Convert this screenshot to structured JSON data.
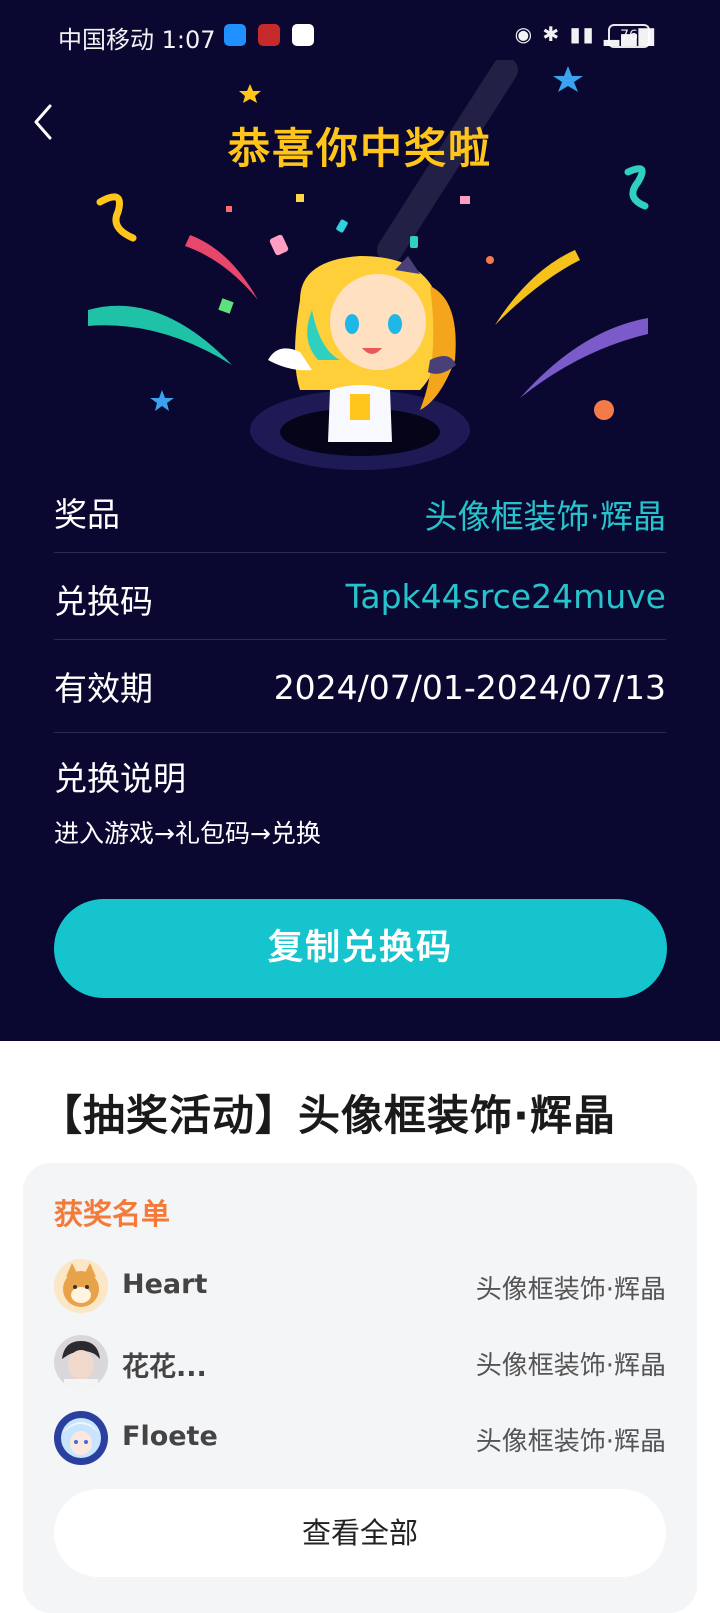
{
  "status_bar": {
    "carrier_time": "中国移动 1:07",
    "battery": "76"
  },
  "header": {
    "title": "恭喜你中奖啦"
  },
  "prize_info": {
    "prize_label": "奖品",
    "prize_value": "头像框装饰·辉晶",
    "code_label": "兑换码",
    "code_value": "Tapk44srce24muve",
    "validity_label": "有效期",
    "validity_value": "2024/07/01-2024/07/13",
    "explain_title": "兑换说明",
    "explain_text": "进入游戏→礼包码→兑换"
  },
  "copy_button": {
    "label": "复制兑换码"
  },
  "activity": {
    "title": "【抽奖活动】头像框装饰·辉晶",
    "winners_title": "获奖名单",
    "winners": [
      {
        "name": "Heart",
        "prize": "头像框装饰·辉晶"
      },
      {
        "name": "花花...",
        "prize": "头像框装饰·辉晶"
      },
      {
        "name": "Floete",
        "prize": "头像框装饰·辉晶"
      }
    ],
    "view_all_label": "查看全部"
  },
  "colors": {
    "top_background": "#0a0830",
    "headline": "#ffc51a",
    "accent_teal": "#15c4cc",
    "winners_title": "#f47a3a"
  }
}
